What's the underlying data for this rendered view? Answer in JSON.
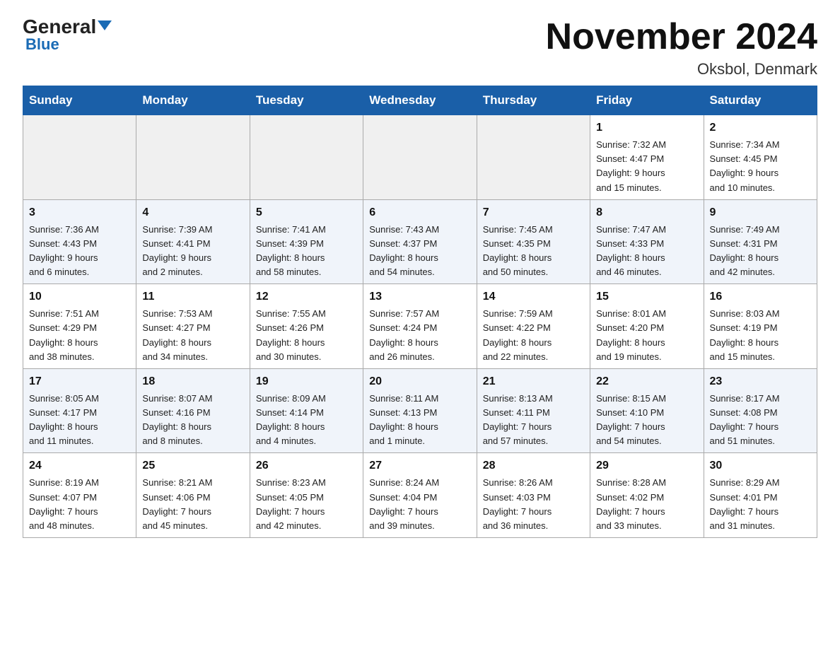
{
  "header": {
    "logo_general": "General",
    "logo_blue": "Blue",
    "month_title": "November 2024",
    "location": "Oksbol, Denmark"
  },
  "weekdays": [
    "Sunday",
    "Monday",
    "Tuesday",
    "Wednesday",
    "Thursday",
    "Friday",
    "Saturday"
  ],
  "weeks": [
    [
      {
        "day": "",
        "info": ""
      },
      {
        "day": "",
        "info": ""
      },
      {
        "day": "",
        "info": ""
      },
      {
        "day": "",
        "info": ""
      },
      {
        "day": "",
        "info": ""
      },
      {
        "day": "1",
        "info": "Sunrise: 7:32 AM\nSunset: 4:47 PM\nDaylight: 9 hours\nand 15 minutes."
      },
      {
        "day": "2",
        "info": "Sunrise: 7:34 AM\nSunset: 4:45 PM\nDaylight: 9 hours\nand 10 minutes."
      }
    ],
    [
      {
        "day": "3",
        "info": "Sunrise: 7:36 AM\nSunset: 4:43 PM\nDaylight: 9 hours\nand 6 minutes."
      },
      {
        "day": "4",
        "info": "Sunrise: 7:39 AM\nSunset: 4:41 PM\nDaylight: 9 hours\nand 2 minutes."
      },
      {
        "day": "5",
        "info": "Sunrise: 7:41 AM\nSunset: 4:39 PM\nDaylight: 8 hours\nand 58 minutes."
      },
      {
        "day": "6",
        "info": "Sunrise: 7:43 AM\nSunset: 4:37 PM\nDaylight: 8 hours\nand 54 minutes."
      },
      {
        "day": "7",
        "info": "Sunrise: 7:45 AM\nSunset: 4:35 PM\nDaylight: 8 hours\nand 50 minutes."
      },
      {
        "day": "8",
        "info": "Sunrise: 7:47 AM\nSunset: 4:33 PM\nDaylight: 8 hours\nand 46 minutes."
      },
      {
        "day": "9",
        "info": "Sunrise: 7:49 AM\nSunset: 4:31 PM\nDaylight: 8 hours\nand 42 minutes."
      }
    ],
    [
      {
        "day": "10",
        "info": "Sunrise: 7:51 AM\nSunset: 4:29 PM\nDaylight: 8 hours\nand 38 minutes."
      },
      {
        "day": "11",
        "info": "Sunrise: 7:53 AM\nSunset: 4:27 PM\nDaylight: 8 hours\nand 34 minutes."
      },
      {
        "day": "12",
        "info": "Sunrise: 7:55 AM\nSunset: 4:26 PM\nDaylight: 8 hours\nand 30 minutes."
      },
      {
        "day": "13",
        "info": "Sunrise: 7:57 AM\nSunset: 4:24 PM\nDaylight: 8 hours\nand 26 minutes."
      },
      {
        "day": "14",
        "info": "Sunrise: 7:59 AM\nSunset: 4:22 PM\nDaylight: 8 hours\nand 22 minutes."
      },
      {
        "day": "15",
        "info": "Sunrise: 8:01 AM\nSunset: 4:20 PM\nDaylight: 8 hours\nand 19 minutes."
      },
      {
        "day": "16",
        "info": "Sunrise: 8:03 AM\nSunset: 4:19 PM\nDaylight: 8 hours\nand 15 minutes."
      }
    ],
    [
      {
        "day": "17",
        "info": "Sunrise: 8:05 AM\nSunset: 4:17 PM\nDaylight: 8 hours\nand 11 minutes."
      },
      {
        "day": "18",
        "info": "Sunrise: 8:07 AM\nSunset: 4:16 PM\nDaylight: 8 hours\nand 8 minutes."
      },
      {
        "day": "19",
        "info": "Sunrise: 8:09 AM\nSunset: 4:14 PM\nDaylight: 8 hours\nand 4 minutes."
      },
      {
        "day": "20",
        "info": "Sunrise: 8:11 AM\nSunset: 4:13 PM\nDaylight: 8 hours\nand 1 minute."
      },
      {
        "day": "21",
        "info": "Sunrise: 8:13 AM\nSunset: 4:11 PM\nDaylight: 7 hours\nand 57 minutes."
      },
      {
        "day": "22",
        "info": "Sunrise: 8:15 AM\nSunset: 4:10 PM\nDaylight: 7 hours\nand 54 minutes."
      },
      {
        "day": "23",
        "info": "Sunrise: 8:17 AM\nSunset: 4:08 PM\nDaylight: 7 hours\nand 51 minutes."
      }
    ],
    [
      {
        "day": "24",
        "info": "Sunrise: 8:19 AM\nSunset: 4:07 PM\nDaylight: 7 hours\nand 48 minutes."
      },
      {
        "day": "25",
        "info": "Sunrise: 8:21 AM\nSunset: 4:06 PM\nDaylight: 7 hours\nand 45 minutes."
      },
      {
        "day": "26",
        "info": "Sunrise: 8:23 AM\nSunset: 4:05 PM\nDaylight: 7 hours\nand 42 minutes."
      },
      {
        "day": "27",
        "info": "Sunrise: 8:24 AM\nSunset: 4:04 PM\nDaylight: 7 hours\nand 39 minutes."
      },
      {
        "day": "28",
        "info": "Sunrise: 8:26 AM\nSunset: 4:03 PM\nDaylight: 7 hours\nand 36 minutes."
      },
      {
        "day": "29",
        "info": "Sunrise: 8:28 AM\nSunset: 4:02 PM\nDaylight: 7 hours\nand 33 minutes."
      },
      {
        "day": "30",
        "info": "Sunrise: 8:29 AM\nSunset: 4:01 PM\nDaylight: 7 hours\nand 31 minutes."
      }
    ]
  ]
}
